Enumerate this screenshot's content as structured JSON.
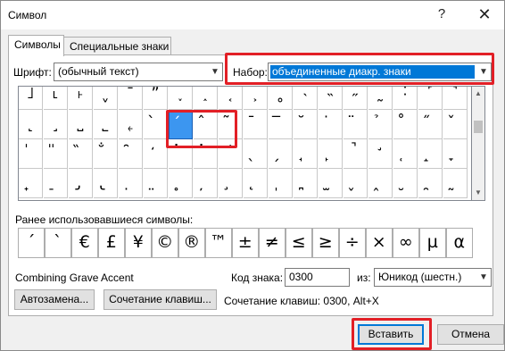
{
  "window": {
    "title": "Символ",
    "help_label": "?",
    "close_label": "✕"
  },
  "tabs": [
    {
      "label": "Символы",
      "active": true
    },
    {
      "label": "Специальные знаки",
      "active": false
    }
  ],
  "font": {
    "label": "Шрифт:",
    "value": "(обычный текст)"
  },
  "subset": {
    "label": "Набор:",
    "value": "объединенные диакр. знаки"
  },
  "grid": {
    "rows": [
      [
        "˩",
        "˪",
        "˫",
        "ˬ",
        "˭",
        "ˮ",
        "˯",
        "˰",
        "˱",
        "˲",
        "˳",
        "˴",
        "˵",
        "˶",
        "˷",
        "˸",
        "˹",
        "˺"
      ],
      [
        "˻",
        "˼",
        "˽",
        "˾",
        "˿",
        "̀",
        "́",
        "̂",
        "̃",
        "̄",
        "̅",
        "̆",
        "̇",
        "̈",
        "̉",
        "̊",
        "̋",
        "̌"
      ],
      [
        "̍",
        "̎",
        "̏",
        "̐",
        "̑",
        "̒",
        "̓",
        "̔",
        "̕",
        "̖",
        "̗",
        "̘",
        "̙",
        "̚",
        "̛",
        "̜",
        "̝",
        "̞"
      ],
      [
        "̟",
        "̠",
        "̡",
        "̢",
        "̣",
        "̤",
        "̥",
        "̦",
        "̧",
        "̨",
        "̩",
        "̪",
        "̫",
        "̬",
        "̭",
        "̮",
        "̯",
        "̰"
      ]
    ],
    "selected": {
      "row": 1,
      "col": 6
    }
  },
  "recent": {
    "label": "Ранее использовавшиеся символы:",
    "symbols": [
      "´",
      "`",
      "€",
      "£",
      "¥",
      "©",
      "®",
      "™",
      "±",
      "≠",
      "≤",
      "≥",
      "÷",
      "×",
      "∞",
      "µ",
      "α"
    ]
  },
  "char_name": "Combining Grave Accent",
  "code": {
    "label": "Код знака:",
    "value": "0300"
  },
  "from": {
    "label": "из:",
    "value": "Юникод (шестн.)"
  },
  "buttons": {
    "autocorrect": "Автозамена...",
    "shortcut_key": "Сочетание клавиш...",
    "insert": "Вставить",
    "cancel": "Отмена"
  },
  "shortcut_text": "Сочетание клавиш: 0300, Alt+X",
  "highlight_color": "#e21f26"
}
